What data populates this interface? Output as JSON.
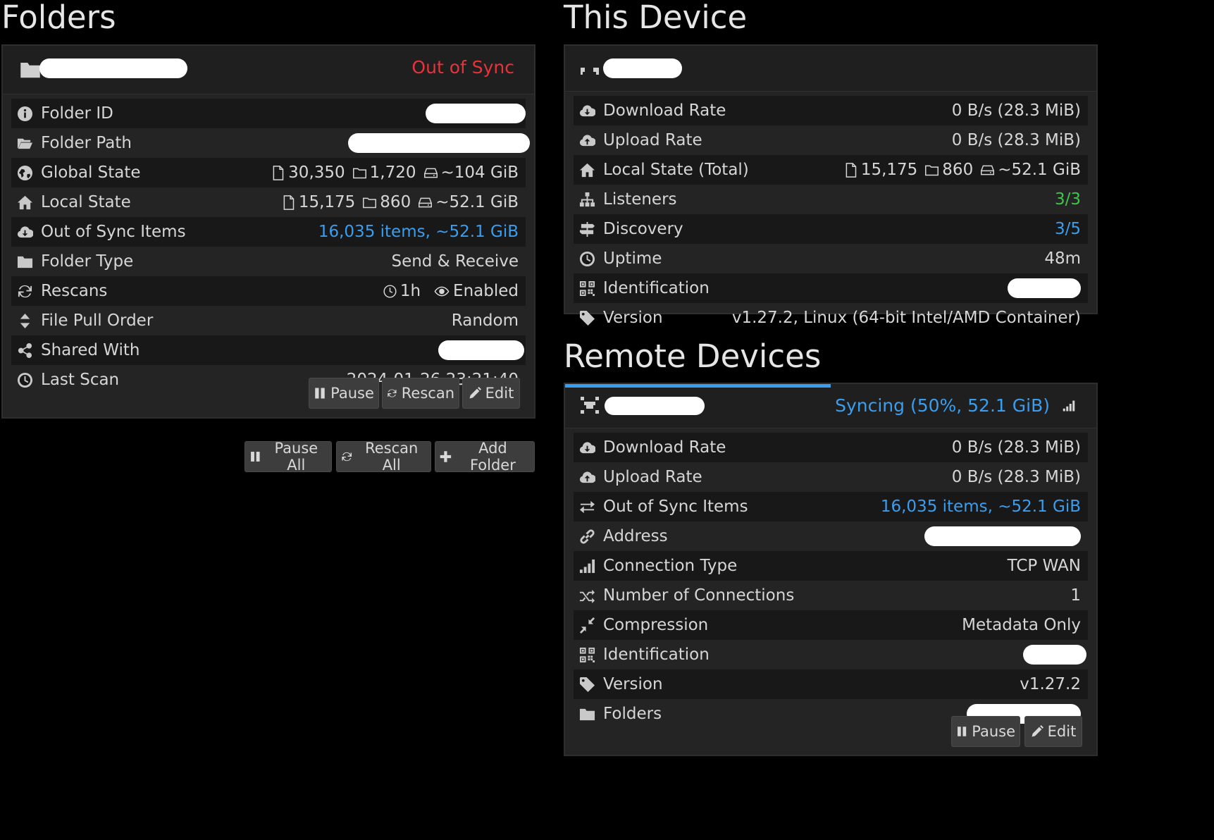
{
  "folders": {
    "title": "Folders",
    "panel": {
      "status": "Out of Sync",
      "rows": [
        {
          "label": "Folder ID"
        },
        {
          "label": "Folder Path"
        },
        {
          "label": "Global State",
          "files": "30,350",
          "dirs": "1,720",
          "size": "~104 GiB"
        },
        {
          "label": "Local State",
          "files": "15,175",
          "dirs": "860",
          "size": "~52.1 GiB"
        },
        {
          "label": "Out of Sync Items",
          "value": "16,035 items, ~52.1 GiB"
        },
        {
          "label": "Folder Type",
          "value": "Send & Receive"
        },
        {
          "label": "Rescans",
          "interval": "1h",
          "watch": "Enabled"
        },
        {
          "label": "File Pull Order",
          "value": "Random"
        },
        {
          "label": "Shared With"
        },
        {
          "label": "Last Scan",
          "value": "2024-01-26 23:21:40"
        }
      ],
      "buttons": {
        "pause": "Pause",
        "rescan": "Rescan",
        "edit": "Edit"
      }
    },
    "actions": {
      "pause_all": "Pause All",
      "rescan_all": "Rescan All",
      "add_folder": "Add Folder"
    }
  },
  "this_device": {
    "title": "This Device",
    "rows": [
      {
        "label": "Download Rate",
        "value": "0 B/s (28.3 MiB)"
      },
      {
        "label": "Upload Rate",
        "value": "0 B/s (28.3 MiB)"
      },
      {
        "label": "Local State (Total)",
        "files": "15,175",
        "dirs": "860",
        "size": "~52.1 GiB"
      },
      {
        "label": "Listeners",
        "value": "3/3"
      },
      {
        "label": "Discovery",
        "value": "3/5"
      },
      {
        "label": "Uptime",
        "value": "48m"
      },
      {
        "label": "Identification"
      },
      {
        "label": "Version",
        "value": "v1.27.2, Linux (64-bit Intel/AMD Container)"
      }
    ]
  },
  "remote_devices": {
    "title": "Remote Devices",
    "panel": {
      "status": "Syncing (50%, 52.1 GiB)",
      "progress": 0.5,
      "rows": [
        {
          "label": "Download Rate",
          "value": "0 B/s (28.3 MiB)"
        },
        {
          "label": "Upload Rate",
          "value": "0 B/s (28.3 MiB)"
        },
        {
          "label": "Out of Sync Items",
          "value": "16,035 items, ~52.1 GiB"
        },
        {
          "label": "Address"
        },
        {
          "label": "Connection Type",
          "value": "TCP WAN"
        },
        {
          "label": "Number of Connections",
          "value": "1"
        },
        {
          "label": "Compression",
          "value": "Metadata Only"
        },
        {
          "label": "Identification"
        },
        {
          "label": "Version",
          "value": "v1.27.2"
        },
        {
          "label": "Folders"
        }
      ],
      "buttons": {
        "pause": "Pause",
        "edit": "Edit"
      }
    }
  },
  "colors": {
    "accent_blue": "#3a9ef0",
    "out_of_sync_red": "#e8333a",
    "ok_green": "#3ec64a"
  }
}
